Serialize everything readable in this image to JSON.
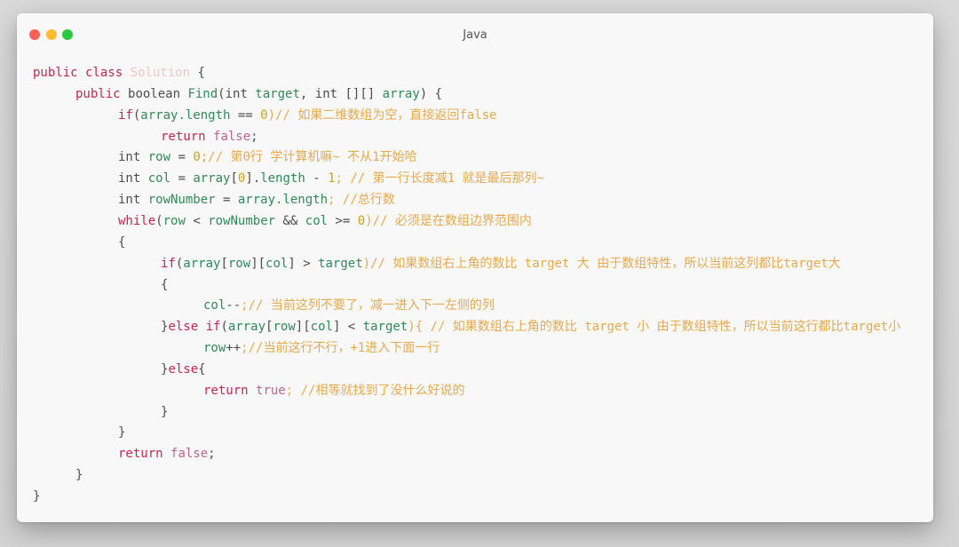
{
  "window": {
    "title": "Java",
    "traffic_lights": [
      {
        "name": "close",
        "color": "#ff5f57"
      },
      {
        "name": "minimize",
        "color": "#febc2e"
      },
      {
        "name": "zoom",
        "color": "#28c840"
      }
    ]
  },
  "colors": {
    "keyword": "#c7254e",
    "class_name": "#f1c6c6",
    "type": "#4d4d4d",
    "identifier": "#2e8b57",
    "number": "#d4a017",
    "comment": "#e8a94a",
    "punct": "#4d4d4d",
    "literal": "#c0628a"
  },
  "code_lines": [
    {
      "indent": 0,
      "tokens": [
        {
          "t": "public class ",
          "c": "keyword"
        },
        {
          "t": "Solution",
          "c": "class_name"
        },
        {
          "t": " {",
          "c": "punct"
        }
      ]
    },
    {
      "indent": 1,
      "tokens": [
        {
          "t": "public ",
          "c": "keyword"
        },
        {
          "t": "boolean ",
          "c": "type"
        },
        {
          "t": "Find",
          "c": "identifier"
        },
        {
          "t": "(int ",
          "c": "type"
        },
        {
          "t": "target",
          "c": "identifier"
        },
        {
          "t": ", int [][] ",
          "c": "type"
        },
        {
          "t": "array",
          "c": "identifier"
        },
        {
          "t": ") {",
          "c": "punct"
        }
      ]
    },
    {
      "indent": 2,
      "tokens": [
        {
          "t": "if",
          "c": "keyword"
        },
        {
          "t": "(",
          "c": "punct"
        },
        {
          "t": "array.length",
          "c": "identifier"
        },
        {
          "t": " == ",
          "c": "punct"
        },
        {
          "t": "0",
          "c": "number"
        },
        {
          "t": ")// 如果二维数组为空，直接返回false",
          "c": "comment"
        }
      ]
    },
    {
      "indent": 3,
      "tokens": [
        {
          "t": "return ",
          "c": "keyword"
        },
        {
          "t": "false",
          "c": "literal"
        },
        {
          "t": ";",
          "c": "punct"
        }
      ]
    },
    {
      "indent": 2,
      "tokens": [
        {
          "t": "int ",
          "c": "type"
        },
        {
          "t": "row",
          "c": "identifier"
        },
        {
          "t": " = ",
          "c": "punct"
        },
        {
          "t": "0",
          "c": "number"
        },
        {
          "t": ";// 第0行 学计算机嘛~ 不从1开始哈",
          "c": "comment"
        }
      ]
    },
    {
      "indent": 2,
      "tokens": [
        {
          "t": "int ",
          "c": "type"
        },
        {
          "t": "col",
          "c": "identifier"
        },
        {
          "t": " = ",
          "c": "punct"
        },
        {
          "t": "array",
          "c": "identifier"
        },
        {
          "t": "[",
          "c": "punct"
        },
        {
          "t": "0",
          "c": "number"
        },
        {
          "t": "].",
          "c": "punct"
        },
        {
          "t": "length",
          "c": "identifier"
        },
        {
          "t": " - ",
          "c": "punct"
        },
        {
          "t": "1",
          "c": "number"
        },
        {
          "t": "; // 第一行长度减1 就是最后那列~",
          "c": "comment"
        }
      ]
    },
    {
      "indent": 2,
      "tokens": [
        {
          "t": "int ",
          "c": "type"
        },
        {
          "t": "rowNumber",
          "c": "identifier"
        },
        {
          "t": " = ",
          "c": "punct"
        },
        {
          "t": "array.length",
          "c": "identifier"
        },
        {
          "t": "; //总行数",
          "c": "comment"
        }
      ]
    },
    {
      "indent": 2,
      "tokens": [
        {
          "t": "while",
          "c": "keyword"
        },
        {
          "t": "(",
          "c": "punct"
        },
        {
          "t": "row",
          "c": "identifier"
        },
        {
          "t": " < ",
          "c": "punct"
        },
        {
          "t": "rowNumber",
          "c": "identifier"
        },
        {
          "t": " && ",
          "c": "punct"
        },
        {
          "t": "col",
          "c": "identifier"
        },
        {
          "t": " >= ",
          "c": "punct"
        },
        {
          "t": "0",
          "c": "number"
        },
        {
          "t": ")// 必须是在数组边界范围内",
          "c": "comment"
        }
      ]
    },
    {
      "indent": 2,
      "tokens": [
        {
          "t": "{",
          "c": "punct"
        }
      ]
    },
    {
      "indent": 3,
      "tokens": [
        {
          "t": "if",
          "c": "keyword"
        },
        {
          "t": "(",
          "c": "punct"
        },
        {
          "t": "array",
          "c": "identifier"
        },
        {
          "t": "[",
          "c": "punct"
        },
        {
          "t": "row",
          "c": "identifier"
        },
        {
          "t": "][",
          "c": "punct"
        },
        {
          "t": "col",
          "c": "identifier"
        },
        {
          "t": "] > ",
          "c": "punct"
        },
        {
          "t": "target",
          "c": "identifier"
        },
        {
          "t": ")// 如果数组右上角的数比 target 大 由于数组特性，所以当前这列都比target大",
          "c": "comment"
        }
      ]
    },
    {
      "indent": 3,
      "tokens": [
        {
          "t": "{",
          "c": "punct"
        }
      ]
    },
    {
      "indent": 4,
      "tokens": [
        {
          "t": "col",
          "c": "identifier"
        },
        {
          "t": "--",
          "c": "punct"
        },
        {
          "t": ";// 当前这列不要了，减一进入下一左侧的列",
          "c": "comment"
        }
      ]
    },
    {
      "indent": 3,
      "tokens": [
        {
          "t": "}",
          "c": "punct"
        },
        {
          "t": "else if",
          "c": "keyword"
        },
        {
          "t": "(",
          "c": "punct"
        },
        {
          "t": "array",
          "c": "identifier"
        },
        {
          "t": "[",
          "c": "punct"
        },
        {
          "t": "row",
          "c": "identifier"
        },
        {
          "t": "][",
          "c": "punct"
        },
        {
          "t": "col",
          "c": "identifier"
        },
        {
          "t": "] < ",
          "c": "punct"
        },
        {
          "t": "target",
          "c": "identifier"
        },
        {
          "t": "){ // 如果数组右上角的数比 target 小 由于数组特性，所以当前这行都比target小",
          "c": "comment"
        }
      ]
    },
    {
      "indent": 4,
      "tokens": [
        {
          "t": "row",
          "c": "identifier"
        },
        {
          "t": "++",
          "c": "punct"
        },
        {
          "t": ";//当前这行不行，+1进入下面一行",
          "c": "comment"
        }
      ]
    },
    {
      "indent": 3,
      "tokens": [
        {
          "t": "}",
          "c": "punct"
        },
        {
          "t": "else",
          "c": "keyword"
        },
        {
          "t": "{",
          "c": "punct"
        }
      ]
    },
    {
      "indent": 4,
      "tokens": [
        {
          "t": "return ",
          "c": "keyword"
        },
        {
          "t": "true",
          "c": "literal"
        },
        {
          "t": "; //相等就找到了没什么好说的",
          "c": "comment"
        }
      ]
    },
    {
      "indent": 3,
      "tokens": [
        {
          "t": "}",
          "c": "punct"
        }
      ]
    },
    {
      "indent": 2,
      "tokens": [
        {
          "t": "}",
          "c": "punct"
        }
      ]
    },
    {
      "indent": 2,
      "tokens": [
        {
          "t": "return ",
          "c": "keyword"
        },
        {
          "t": "false",
          "c": "literal"
        },
        {
          "t": ";",
          "c": "punct"
        }
      ]
    },
    {
      "indent": 1,
      "tokens": [
        {
          "t": "}",
          "c": "punct"
        }
      ]
    },
    {
      "indent": 0,
      "tokens": [
        {
          "t": "}",
          "c": "punct"
        }
      ]
    }
  ]
}
